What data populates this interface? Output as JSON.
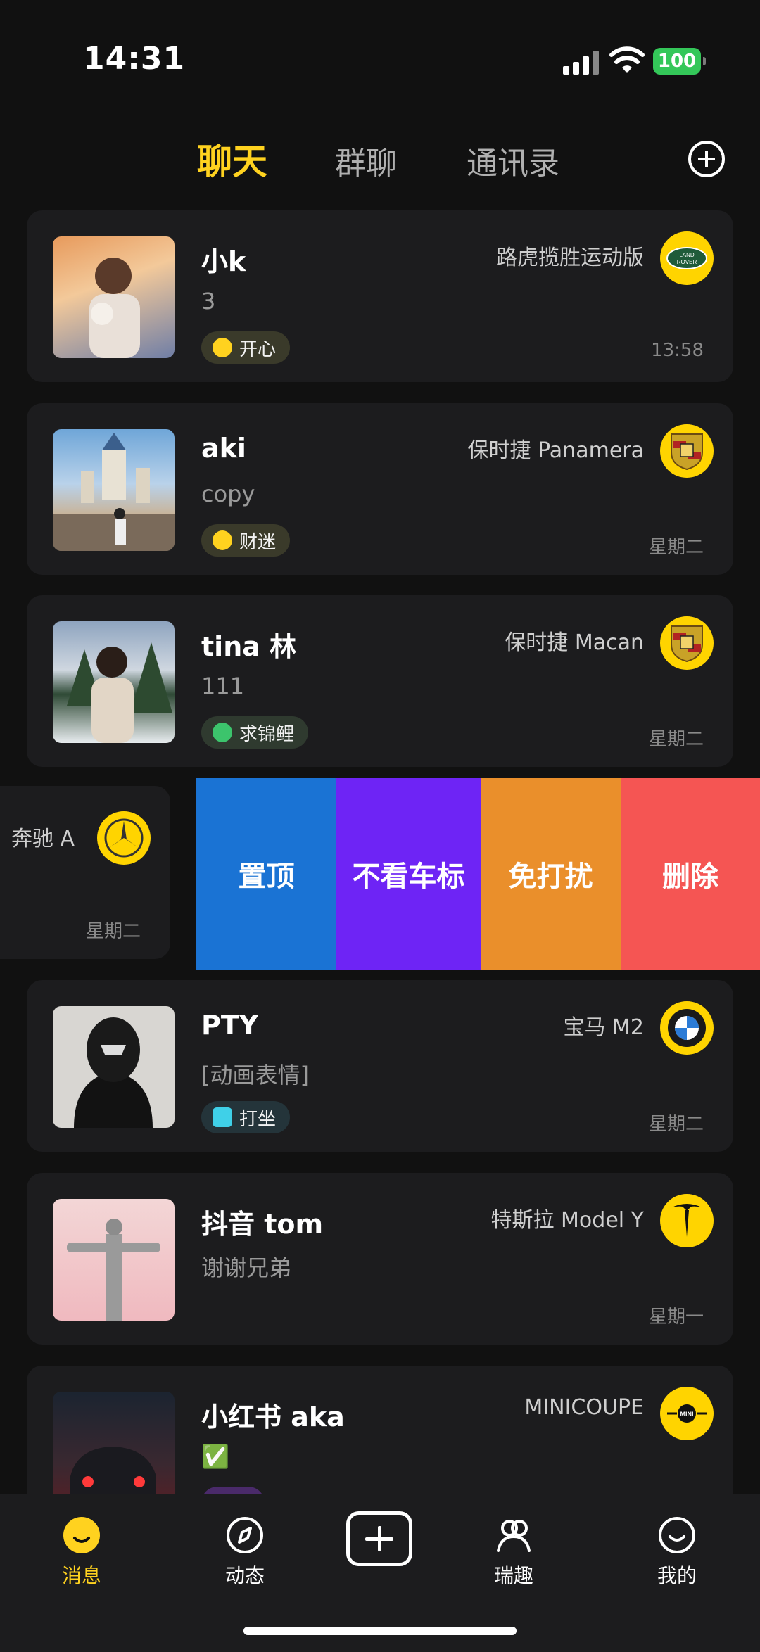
{
  "status_bar": {
    "time": "14:31",
    "battery": "100"
  },
  "tabs": [
    {
      "label": "聊天",
      "active": true
    },
    {
      "label": "群聊",
      "active": false
    },
    {
      "label": "通讯录",
      "active": false
    }
  ],
  "chats": [
    {
      "name": "小k",
      "message": "3",
      "mood": "开心",
      "car": "路虎揽胜运动版",
      "brand_icon": "land-rover-logo",
      "time": "13:58"
    },
    {
      "name": "aki",
      "message": "copy",
      "mood": "财迷",
      "car": "保时捷 Panamera",
      "brand_icon": "porsche-logo",
      "time": "星期二"
    },
    {
      "name": "tina 林",
      "message": "111",
      "mood": "求锦鲤",
      "car": "保时捷 Macan",
      "brand_icon": "porsche-logo",
      "time": "星期二"
    },
    {
      "name": "PTY",
      "message": "[动画表情]",
      "mood": "打坐",
      "car": "宝马 M2",
      "brand_icon": "bmw-logo",
      "time": "星期二"
    },
    {
      "name": "抖音 tom",
      "message": "谢谢兄弟",
      "mood": "",
      "car": "特斯拉 Model Y",
      "brand_icon": "tesla-logo",
      "time": "星期一"
    },
    {
      "name": "小红书 aka",
      "message": "✅",
      "mood": "",
      "car": "MINICOUPE",
      "brand_icon": "mini-logo",
      "time": ""
    }
  ],
  "swiped_row": {
    "car": "奔驰 A",
    "brand_icon": "mercedes-logo",
    "time": "星期二"
  },
  "swipe_actions": [
    {
      "label": "置顶",
      "color": "#1a73d4"
    },
    {
      "label": "不看车标",
      "color": "#6e24f5"
    },
    {
      "label": "免打扰",
      "color": "#ea8f2b"
    },
    {
      "label": "删除",
      "color": "#f55553"
    }
  ],
  "bottom_nav": [
    {
      "label": "消息",
      "active": true
    },
    {
      "label": "动态",
      "active": false
    },
    {
      "label": "瑞趣",
      "active": false
    },
    {
      "label": "我的",
      "active": false
    }
  ],
  "colors": {
    "accent": "#ffd21f",
    "card_bg": "#1c1c1e",
    "page_bg": "#111111"
  }
}
